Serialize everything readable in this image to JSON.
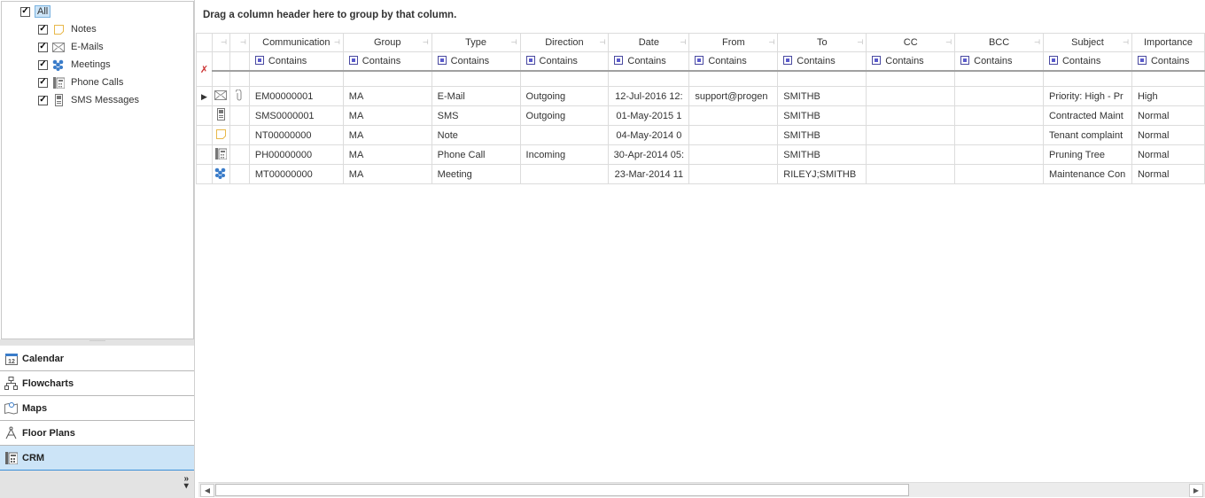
{
  "tree": {
    "root": {
      "label": "All",
      "checked": true
    },
    "items": [
      {
        "label": "Notes",
        "icon": "note-icon",
        "checked": true
      },
      {
        "label": "E-Mails",
        "icon": "envelope-icon",
        "checked": true
      },
      {
        "label": "Meetings",
        "icon": "people-icon",
        "checked": true
      },
      {
        "label": "Phone Calls",
        "icon": "phone-icon",
        "checked": true
      },
      {
        "label": "SMS Messages",
        "icon": "mobile-icon",
        "checked": true
      }
    ]
  },
  "nav": [
    {
      "label": "Calendar",
      "icon": "calendar-icon"
    },
    {
      "label": "Flowcharts",
      "icon": "flowchart-icon"
    },
    {
      "label": "Maps",
      "icon": "map-icon"
    },
    {
      "label": "Floor Plans",
      "icon": "compass-icon"
    },
    {
      "label": "CRM",
      "icon": "crm-icon",
      "selected": true
    }
  ],
  "group_panel": "Drag a column header here to group by that column.",
  "filter_label": "Contains",
  "columns": [
    "Communication",
    "Group",
    "Type",
    "Direction",
    "Date",
    "From",
    "To",
    "CC",
    "BCC",
    "Subject",
    "Importance"
  ],
  "rows": [
    {
      "icon": "envelope-icon",
      "attach": true,
      "current": true,
      "cells": [
        "EM00000001",
        "MA",
        "E-Mail",
        "Outgoing",
        "12-Jul-2016 12:",
        "support@progen",
        "SMITHB",
        "",
        "",
        "Priority: High - Pr",
        "High"
      ]
    },
    {
      "icon": "mobile-icon",
      "cells": [
        "SMS0000001",
        "MA",
        "SMS",
        "Outgoing",
        "01-May-2015 1",
        "",
        "SMITHB",
        "",
        "",
        "Contracted Maint",
        "Normal"
      ]
    },
    {
      "icon": "note-icon",
      "cells": [
        "NT00000000",
        "MA",
        "Note",
        "",
        "04-May-2014 0",
        "",
        "SMITHB",
        "",
        "",
        "Tenant complaint",
        "Normal"
      ]
    },
    {
      "icon": "phone-icon",
      "cells": [
        "PH00000000",
        "MA",
        "Phone Call",
        "Incoming",
        "30-Apr-2014 05:",
        "",
        "SMITHB",
        "",
        "",
        "Pruning Tree",
        "Normal"
      ]
    },
    {
      "icon": "people-icon",
      "cells": [
        "MT00000000",
        "MA",
        "Meeting",
        "",
        "23-Mar-2014 11",
        "",
        "RILEYJ;SMITHB",
        "",
        "",
        "Maintenance Con",
        "Normal"
      ]
    }
  ]
}
